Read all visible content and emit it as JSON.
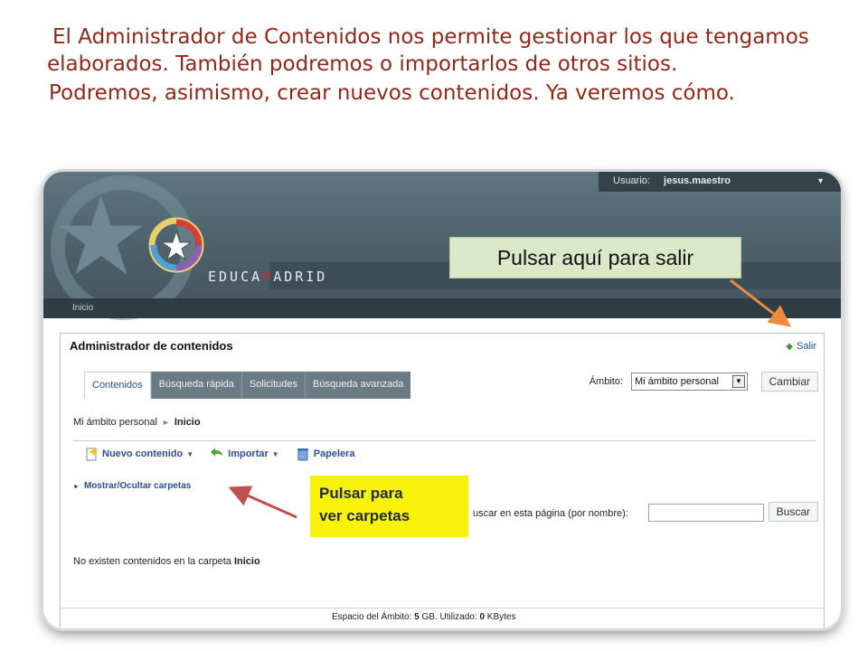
{
  "slide": {
    "intro_line1": "El Administrador de Contenidos nos permite gestionar los que tengamos elaborados. También podremos o importarlos de otros sitios.",
    "intro_line2": "Podremos, asimismo, crear nuevos contenidos. Ya veremos cómo."
  },
  "app": {
    "brand_prefix": "EDUCA",
    "brand_m": "M",
    "brand_suffix": "ADRID",
    "user_label": "Usuario:",
    "user_name": "jesus.maestro",
    "nav_home": "Inicio",
    "panel_title": "Administrador de contenidos",
    "exit_label": "Salir",
    "tabs": [
      {
        "label": "Contenidos"
      },
      {
        "label": "Búsqueda rápida"
      },
      {
        "label": "Solicitudes"
      },
      {
        "label": "Búsqueda avanzada"
      }
    ],
    "ambito_label": "Ámbito:",
    "ambito_value": "Mi ámbito personal",
    "cambiar_label": "Cambiar",
    "breadcrumb_root": "Mi ámbito personal",
    "breadcrumb_current": "Inicio",
    "toolbar": {
      "new_content": "Nuevo contenido",
      "import": "Importar",
      "trash": "Papelera"
    },
    "folders_toggle": "Mostrar/Ocultar carpetas",
    "search_label": "uscar en esta página (por nombre):",
    "search_button": "Buscar",
    "empty_prefix": "No existen contenidos en la carpeta",
    "empty_folder": "Inicio",
    "footer": {
      "space_label": "Espacio del Ámbito:",
      "space_value": "5",
      "space_unit": "GB. Utilizado:",
      "used_value": "0",
      "used_unit": "KBytes"
    }
  },
  "callouts": {
    "exit_hint": "Pulsar aquí para salir",
    "folders_hint_line1": "Pulsar para",
    "folders_hint_line2": "ver carpetas"
  },
  "colors": {
    "intro_text": "#8b2a1a",
    "banner": "#5f7681",
    "callout_blue": "#dbe8c7",
    "callout_yellow": "#f8f20a",
    "arrow_orange": "#f08a3c",
    "arrow_red": "#c0504d"
  }
}
